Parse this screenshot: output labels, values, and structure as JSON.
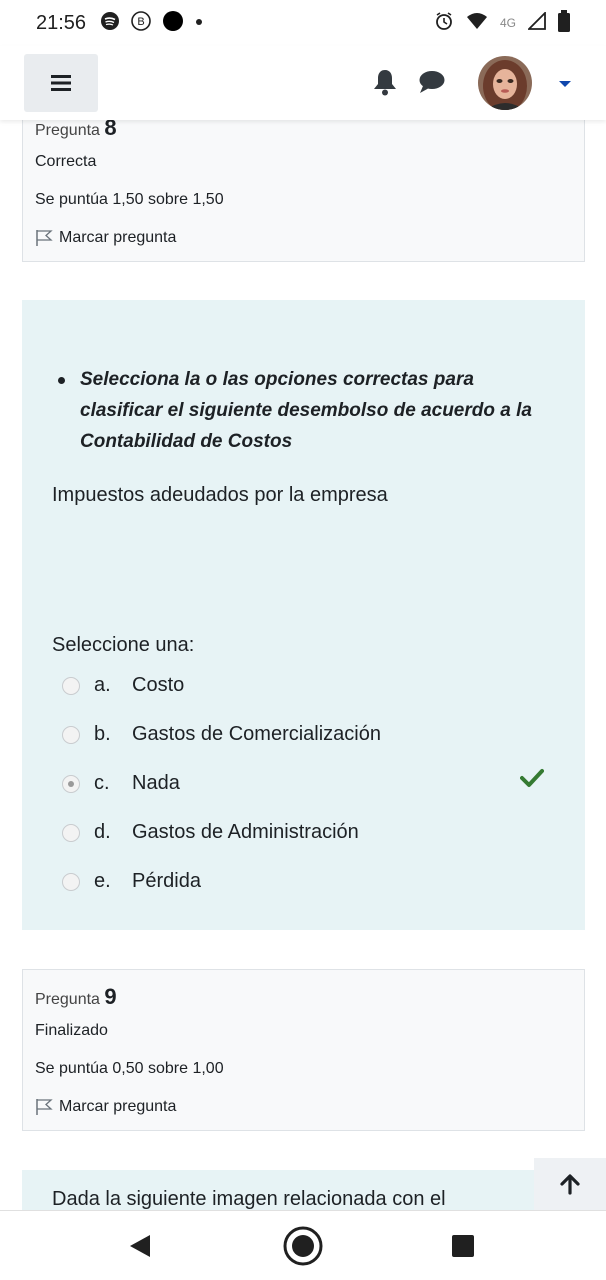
{
  "status_bar": {
    "time": "21:56",
    "network": "4G",
    "icons": [
      "spotify-icon",
      "b-icon",
      "dot-icon",
      "alarm-icon",
      "wifi-icon",
      "signal-icon",
      "battery-icon"
    ]
  },
  "navbar": {
    "icons": [
      "hamburger-icon",
      "bell-icon",
      "chat-icon",
      "avatar",
      "caret-down-icon"
    ]
  },
  "question8": {
    "label": "Pregunta",
    "number": "8",
    "state": "Correcta",
    "grade": "Se puntúa 1,50 sobre 1,50",
    "flag": "Marcar pregunta",
    "instruction": "Selecciona la o las opciones correctas para clasificar el siguiente desembolso de acuerdo a la Contabilidad de Costos",
    "statement": "Impuestos adeudados por la empresa",
    "prompt": "Seleccione una:",
    "options": [
      {
        "letter": "a.",
        "text": "Costo",
        "selected": false
      },
      {
        "letter": "b.",
        "text": "Gastos de Comercialización",
        "selected": false
      },
      {
        "letter": "c.",
        "text": "Nada",
        "selected": true
      },
      {
        "letter": "d.",
        "text": "Gastos de Administración",
        "selected": false
      },
      {
        "letter": "e.",
        "text": "Pérdida",
        "selected": false
      }
    ]
  },
  "question9": {
    "label": "Pregunta",
    "number": "9",
    "state": "Finalizado",
    "grade": "Se puntúa 0,50 sobre 1,00",
    "flag": "Marcar pregunta",
    "partial_text": "Dada la siguiente imagen relacionada con el"
  },
  "colors": {
    "formulation_bg": "#e7f3f5",
    "info_bg": "#f8f9fa",
    "check_green": "#357a32",
    "caret_blue": "#0f47ad"
  }
}
